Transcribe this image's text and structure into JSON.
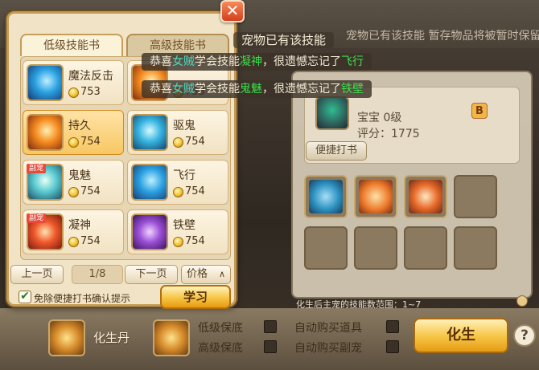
{
  "background": {
    "top_text": "宠物已有该技能 暂存物品将被暂时保留。",
    "pet_name": "宝宝 0级",
    "pet_score": "评分：1775",
    "b_badge": "B",
    "quick_book_label": "便捷打书",
    "range_text": "化生后主宠的技能数范围：1~7"
  },
  "bottom": {
    "pill_label": "化生丹",
    "low_protect_label": "低级保底",
    "high_protect_label": "高级保底",
    "auto_buy_item_label": "自动购买道具",
    "auto_buy_pet_label": "自动购买副宠",
    "huasheng_label": "化生",
    "help_label": "?"
  },
  "book_panel": {
    "tabs": [
      {
        "label": "低级技能书",
        "active": true
      },
      {
        "label": "高级技能书",
        "active": false
      }
    ],
    "items": [
      {
        "name": "魔法反击",
        "price": "753",
        "icon": "blue-swirl"
      },
      {
        "name": "",
        "price": "753",
        "icon": "orange-burst"
      },
      {
        "name": "持久",
        "price": "754",
        "icon": "orange-swirl",
        "selected": true
      },
      {
        "name": "驱鬼",
        "price": "754",
        "icon": "ghost-cyan"
      },
      {
        "name": "鬼魅",
        "price": "754",
        "icon": "ghost-teal",
        "tag": "副宠"
      },
      {
        "name": "飞行",
        "price": "754",
        "icon": "blue-wing"
      },
      {
        "name": "凝神",
        "price": "754",
        "icon": "red-spiral",
        "tag": "副宠"
      },
      {
        "name": "铁壁",
        "price": "754",
        "icon": "purple-shield"
      }
    ],
    "prev_page": "上一页",
    "page_indicator": "1/8",
    "next_page": "下一页",
    "price_sort": "价格",
    "price_sort_arrow": "∧",
    "confirm_label": "免除便捷打书确认提示",
    "confirm_checked": "✔",
    "learn_label": "学习",
    "close_label": "✕"
  },
  "toasts": {
    "title": "宠物已有该技能",
    "line1": {
      "prefix": "恭喜",
      "who": "女贼",
      "mid": "学会技能",
      "skill": "凝神",
      "tail": "，很遗憾忘记了",
      "lost": "飞行"
    },
    "line2": {
      "prefix": "恭喜",
      "who": "女贼",
      "mid": "学会技能",
      "skill": "鬼魅",
      "tail": "，很遗憾忘记了",
      "lost": "铁壁"
    }
  },
  "colors": {
    "accent_gold": "#f6c544",
    "panel_bg": "#f1e4c6",
    "highlight_green": "#39e04a",
    "highlight_cyan": "#4fd9c0",
    "close_red": "#d2401c"
  }
}
